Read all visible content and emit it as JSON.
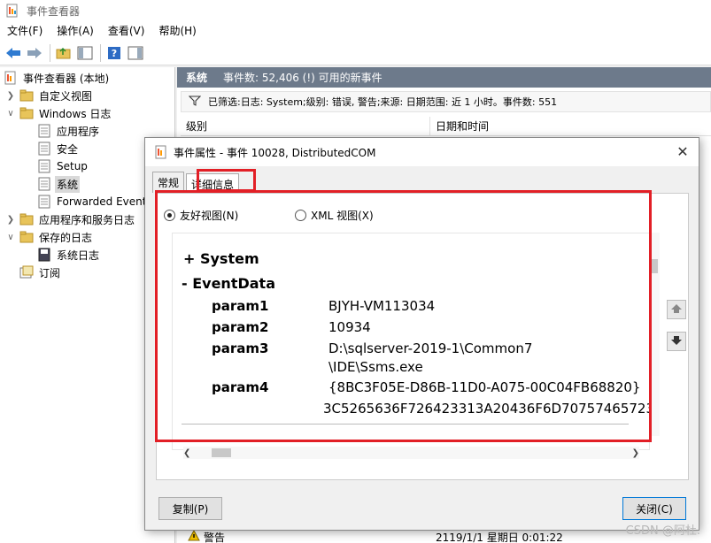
{
  "window": {
    "title": "事件查看器"
  },
  "menu": [
    "文件(F)",
    "操作(A)",
    "查看(V)",
    "帮助(H)"
  ],
  "tree": {
    "root": "事件查看器 (本地)",
    "custom_views": "自定义视图",
    "windows_logs": "Windows 日志",
    "logs": [
      "应用程序",
      "安全",
      "Setup",
      "系统",
      "Forwarded Events"
    ],
    "app_service_logs": "应用程序和服务日志",
    "saved_logs": "保存的日志",
    "saved_system_log": "系统日志",
    "subscriptions": "订阅"
  },
  "right": {
    "header_name": "系统",
    "header_count": "事件数: 52,406 (!) 可用的新事件",
    "filter_text": "已筛选:日志: System;级别: 错误, 警告;来源: 日期范围: 近 1 小时。事件数: 551",
    "col_level": "级别",
    "col_datetime": "日期和时间",
    "bottom_level": "警告",
    "bottom_datetime": "2119/1/1 星期日 0:01:22"
  },
  "dialog": {
    "title": "事件属性 - 事件 10028, DistributedCOM",
    "tab_general": "常规",
    "tab_details": "详细信息",
    "radio_friendly": "友好视图(N)",
    "radio_xml": "XML 视图(X)",
    "section_system": "+ System",
    "section_eventdata": "- EventData",
    "params": [
      {
        "key": "param1",
        "value": "BJYH-VM113034"
      },
      {
        "key": "param2",
        "value": "10934"
      },
      {
        "key": "param3",
        "value": "D:\\sqlserver-2019-1\\Common7",
        "value2": "\\IDE\\Ssms.exe"
      },
      {
        "key": "param4",
        "value": "{8BC3F05E-D86B-11D0-A075-00C04FB68820}",
        "value2": "3C5265636F726423313A20436F6D70757465723"
      }
    ],
    "copy_button": "复制(P)",
    "close_button": "关闭(C)"
  },
  "watermark": "CSDN @阿杜."
}
